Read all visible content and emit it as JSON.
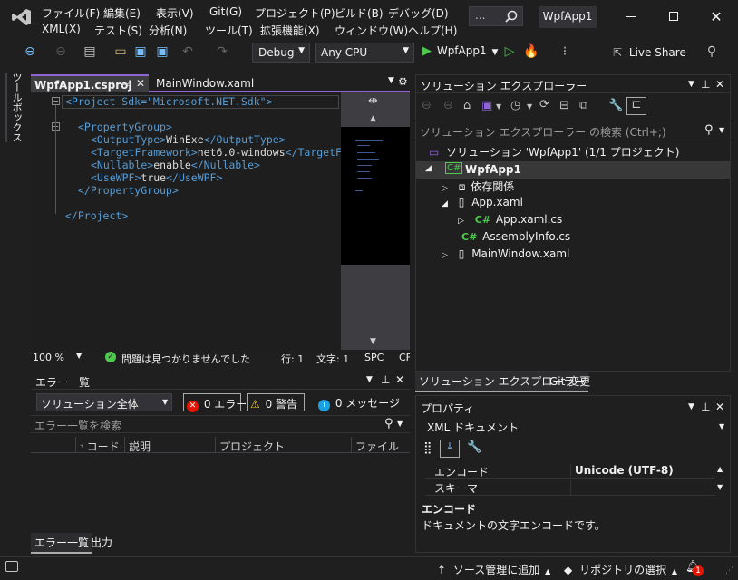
{
  "app": {
    "title": "WpfApp1"
  },
  "menu": [
    "ファイル(F)",
    "編集(E)",
    "表示(V)",
    "Git(G)",
    "プロジェクト(P)",
    "ビルド(B)",
    "デバッグ(D)",
    "XML(X)",
    "テスト(S)",
    "分析(N)",
    "ツール(T)",
    "拡張機能(X)",
    "ウィンドウ(W)",
    "ヘルプ(H)"
  ],
  "search": {
    "label": "..."
  },
  "toolbar": {
    "config": "Debug",
    "platform": "Any CPU",
    "run_target": "WpfApp1",
    "live_share": "Live Share"
  },
  "left_strip": {
    "label": "ツールボックス"
  },
  "editor": {
    "tabs": [
      "WpfApp1.csproj",
      "MainWindow.xaml"
    ],
    "lines": [
      {
        "tag": "<Project Sdk=\"Microsoft.NET.Sdk\">",
        "text": ""
      },
      {
        "tag": "",
        "text": ""
      },
      {
        "tag": "<PropertyGroup>",
        "text": ""
      },
      {
        "tag": "<OutputType>",
        "text": "WinExe",
        "close": "</OutputType>"
      },
      {
        "tag": "<TargetFramework>",
        "text": "net6.0-windows",
        "close": "</TargetF"
      },
      {
        "tag": "<Nullable>",
        "text": "enable",
        "close": "</Nullable>"
      },
      {
        "tag": "<UseWPF>",
        "text": "true",
        "close": "</UseWPF>"
      },
      {
        "tag": "</PropertyGroup>",
        "text": ""
      },
      {
        "tag": "",
        "text": ""
      },
      {
        "tag": "</Project>",
        "text": ""
      }
    ],
    "zoom": "100 %",
    "no_issues": "問題は見つかりませんでした",
    "line": "行: 1",
    "col": "文字: 1",
    "spc": "SPC",
    "crlf": "CF"
  },
  "error_list": {
    "title": "エラー一覧",
    "scope": "ソリューション全体",
    "errors": "0 エラー",
    "warnings": "0 警告",
    "messages": "0 メッセージ",
    "search_placeholder": "エラー一覧を検索",
    "columns": [
      "コード",
      "説明",
      "プロジェクト",
      "ファイル"
    ],
    "bottom_tabs": [
      "エラー一覧",
      "出力"
    ]
  },
  "solution_explorer": {
    "title": "ソリューション エクスプローラー",
    "search_placeholder": "ソリューション エクスプローラー の検索 (Ctrl+;)",
    "solution": "ソリューション 'WpfApp1' (1/1 プロジェクト)",
    "project": "WpfApp1",
    "deps": "依存関係",
    "app_xaml": "App.xaml",
    "app_xaml_cs": "App.xaml.cs",
    "assembly_info": "AssemblyInfo.cs",
    "main_window": "MainWindow.xaml",
    "bottom_tabs": [
      "ソリューション エクスプローラー",
      "Git 変更"
    ]
  },
  "properties": {
    "title": "プロパティ",
    "object": "XML ドキュメント",
    "rows": [
      {
        "name": "エンコード",
        "value": "Unicode (UTF-8)"
      },
      {
        "name": "スキーマ",
        "value": ""
      }
    ],
    "desc_title": "エンコード",
    "desc_text": "ドキュメントの文字エンコードです。"
  },
  "status": {
    "source_control": "ソース管理に追加",
    "repo": "リポジトリの選択",
    "notif_count": "1"
  },
  "colors": {
    "accent": "#007acc",
    "bg": "#1f1f1f",
    "editor": "#1e1e1e",
    "tab_active": "#3e3e40",
    "purple": "#8e64d8"
  }
}
